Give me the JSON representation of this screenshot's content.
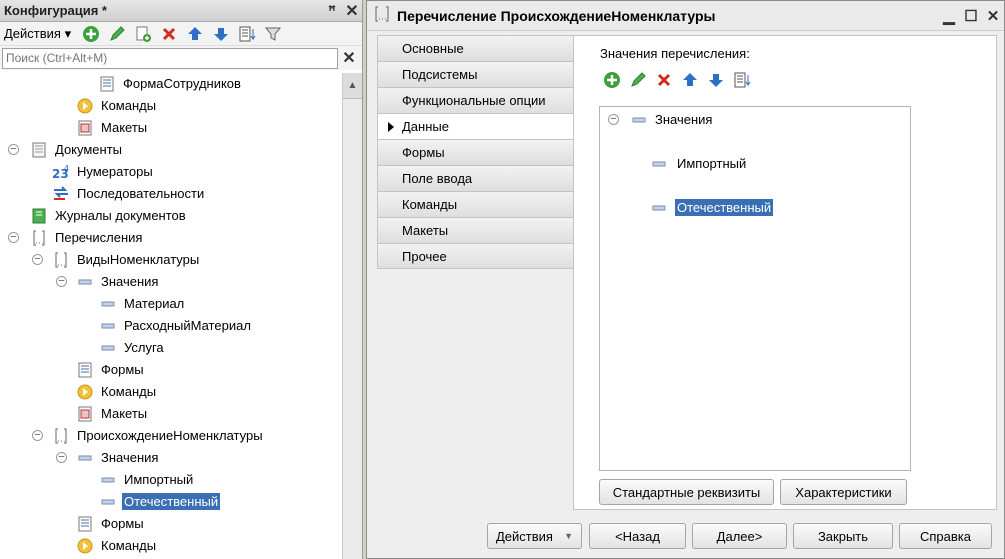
{
  "left_panel": {
    "title": "Конфигурация *",
    "actions_label": "Действия",
    "search_placeholder": "Поиск (Ctrl+Alt+M)"
  },
  "tree": [
    {
      "label": "ФормаСотрудников",
      "icon": "form-icon"
    },
    {
      "label": "Команды",
      "icon": "command-icon"
    },
    {
      "label": "Макеты",
      "icon": "template-icon"
    },
    {
      "label": "Документы",
      "icon": "document-icon",
      "toggle": "−"
    },
    {
      "label": "Нумераторы",
      "icon": "numerator-icon"
    },
    {
      "label": "Последовательности",
      "icon": "sequence-icon"
    },
    {
      "label": "Журналы документов",
      "icon": "journal-icon"
    },
    {
      "label": "Перечисления",
      "icon": "enum-icon",
      "toggle": "−"
    },
    {
      "label": "ВидыНоменклатуры",
      "icon": "enum-icon",
      "toggle": "−"
    },
    {
      "label": "Значения",
      "icon": "value-icon",
      "toggle": "−"
    },
    {
      "label": "Материал",
      "icon": "value-icon"
    },
    {
      "label": "РасходныйМатериал",
      "icon": "value-icon"
    },
    {
      "label": "Услуга",
      "icon": "value-icon"
    },
    {
      "label": "Формы",
      "icon": "form-icon"
    },
    {
      "label": "Команды",
      "icon": "command-icon"
    },
    {
      "label": "Макеты",
      "icon": "template-icon"
    },
    {
      "label": "ПроисхождениеНоменклатуры",
      "icon": "enum-icon",
      "toggle": "−"
    },
    {
      "label": "Значения",
      "icon": "value-icon",
      "toggle": "−"
    },
    {
      "label": "Импортный",
      "icon": "value-icon"
    },
    {
      "label": "Отечественный",
      "icon": "value-icon",
      "selected": true
    },
    {
      "label": "Формы",
      "icon": "form-icon"
    },
    {
      "label": "Команды",
      "icon": "command-icon"
    }
  ],
  "window": {
    "title": "Перечисление ПроисхождениеНоменклатуры",
    "tabs": [
      "Основные",
      "Подсистемы",
      "Функциональные опции",
      "Данные",
      "Формы",
      "Поле ввода",
      "Команды",
      "Макеты",
      "Прочее"
    ],
    "active_tab": "Данные",
    "values_label": "Значения перечисления:",
    "values_root": "Значения",
    "values": [
      "Импортный",
      "Отечественный"
    ],
    "selected_value": "Отечественный",
    "std_attrs_button": "Стандартные реквизиты",
    "characteristics_button": "Характеристики",
    "footer": {
      "actions": "Действия",
      "back": "<Назад",
      "next": "Далее>",
      "close": "Закрыть",
      "help": "Справка"
    }
  },
  "colors": {
    "selection": "#3a6fb5",
    "add": "#3aa13a",
    "delete": "#d42a1a",
    "arrow": "#2c6fc4"
  }
}
